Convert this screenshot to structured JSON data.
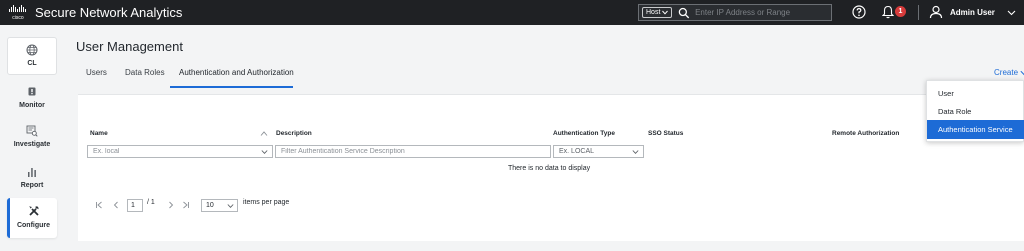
{
  "header": {
    "logo_text": "cisco",
    "app_title": "Secure Network Analytics",
    "search": {
      "scope_label": "Host",
      "placeholder": "Enter IP Address or Range"
    },
    "notification_count": "1",
    "user_name": "Admin User"
  },
  "sidebar": {
    "items": [
      {
        "label": "CL",
        "icon": "globe-icon"
      },
      {
        "label": "Monitor",
        "icon": "monitor-icon"
      },
      {
        "label": "Investigate",
        "icon": "investigate-icon"
      },
      {
        "label": "Report",
        "icon": "bar-chart-icon"
      },
      {
        "label": "Configure",
        "icon": "tools-icon"
      }
    ]
  },
  "page": {
    "title": "User Management",
    "tabs": [
      {
        "label": "Users"
      },
      {
        "label": "Data Roles"
      },
      {
        "label": "Authentication and Authorization"
      }
    ],
    "create_label": "Create"
  },
  "table": {
    "columns": [
      {
        "label": "Name"
      },
      {
        "label": "Description"
      },
      {
        "label": "Authentication Type"
      },
      {
        "label": "SSO Status"
      },
      {
        "label": "Remote Authorization"
      }
    ],
    "filters": {
      "name_placeholder": "Ex. local",
      "description_placeholder": "Filter Authentication Service Description",
      "type_value": "Ex. LOCAL"
    },
    "empty_message": "There is no data to display"
  },
  "pagination": {
    "current_page": "1",
    "total_pages": "/ 1",
    "per_page": "10",
    "per_page_label": "items per page"
  },
  "create_menu": {
    "items": [
      {
        "label": "User"
      },
      {
        "label": "Data Role"
      },
      {
        "label": "Authentication Service"
      }
    ]
  },
  "colors": {
    "accent": "#1d6bd6",
    "topbar": "#1f2124",
    "badge": "#d63b3b"
  }
}
